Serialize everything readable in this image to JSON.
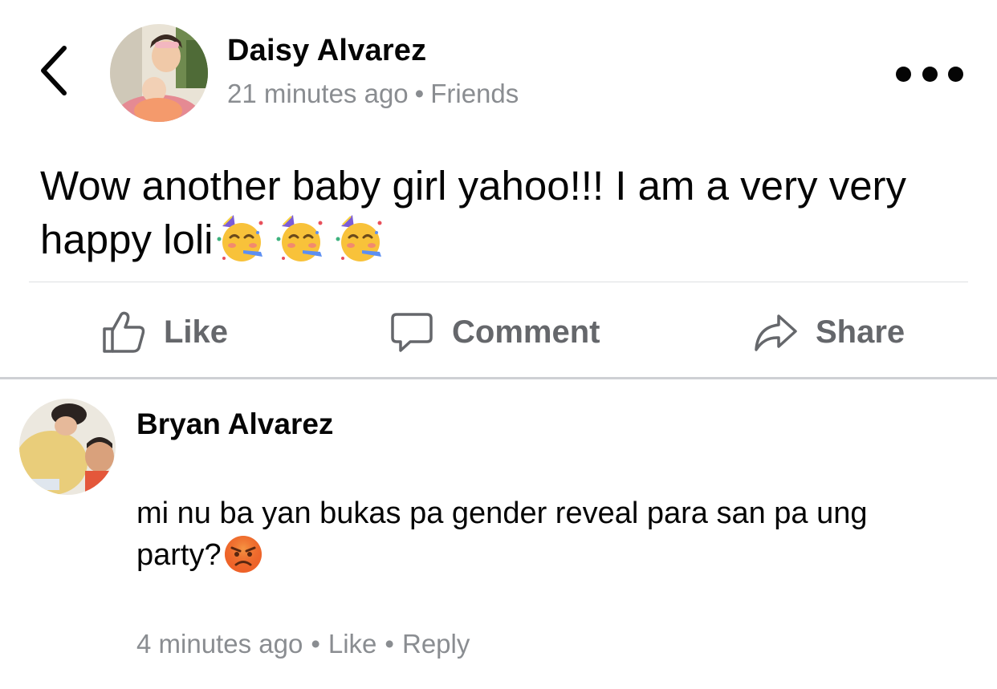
{
  "post": {
    "author_name": "Daisy Alvarez",
    "timestamp": "21 minutes ago",
    "separator": "•",
    "audience": "Friends",
    "text": "Wow another baby girl yahoo!!! I am a very very happy loli",
    "emojis": [
      "partying-face",
      "partying-face",
      "partying-face"
    ]
  },
  "actions": {
    "like_label": "Like",
    "comment_label": "Comment",
    "share_label": "Share"
  },
  "comment": {
    "author_name": "Bryan Alvarez",
    "text": "mi nu ba yan bukas pa gender reveal para san pa ung party?",
    "emoji": "angry-face",
    "timestamp": "4 minutes ago",
    "separator": "•",
    "like_label": "Like",
    "reply_label": "Reply"
  },
  "icons": {
    "back": "chevron-left-icon",
    "more": "more-dots-icon",
    "like": "thumbs-up-icon",
    "comment": "speech-bubble-icon",
    "share": "share-arrow-icon"
  },
  "colors": {
    "text_primary": "#050505",
    "text_secondary": "#8a8d91",
    "action_gray": "#65676b",
    "divider": "#ced0d4"
  }
}
